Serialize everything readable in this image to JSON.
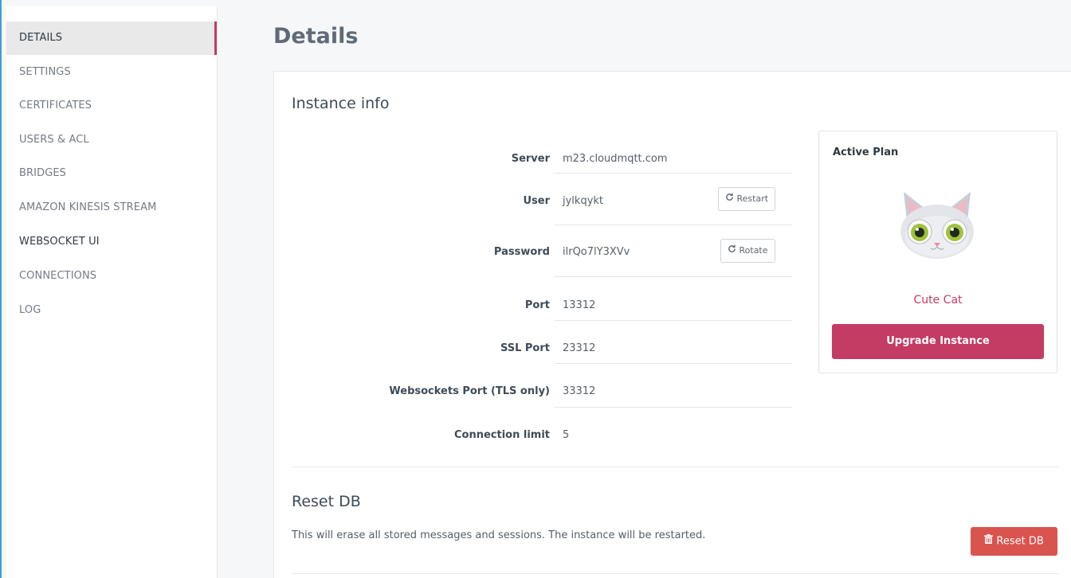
{
  "sidebar": {
    "items": [
      {
        "label": "DETAILS"
      },
      {
        "label": "SETTINGS"
      },
      {
        "label": "CERTIFICATES"
      },
      {
        "label": "USERS & ACL"
      },
      {
        "label": "BRIDGES"
      },
      {
        "label": "AMAZON KINESIS STREAM"
      },
      {
        "label": "WEBSOCKET UI"
      },
      {
        "label": "CONNECTIONS"
      },
      {
        "label": "LOG"
      }
    ],
    "active_index": 0
  },
  "page": {
    "title": "Details"
  },
  "instance_info": {
    "title": "Instance info",
    "rows": [
      {
        "label": "Server",
        "value": "m23.cloudmqtt.com"
      },
      {
        "label": "User",
        "value": "jylkqykt"
      },
      {
        "label": "Password",
        "value": "ilrQo7lY3XVv"
      },
      {
        "label": "Port",
        "value": "13312"
      },
      {
        "label": "SSL Port",
        "value": "23312"
      },
      {
        "label": "Websockets Port (TLS only)",
        "value": "33312"
      },
      {
        "label": "Connection limit",
        "value": "5"
      }
    ],
    "restart_label": "Restart",
    "rotate_label": "Rotate"
  },
  "plan": {
    "heading": "Active Plan",
    "name": "Cute Cat",
    "upgrade_label": "Upgrade Instance",
    "mascot_icon": "cat-mascot-icon"
  },
  "reset_db": {
    "title": "Reset DB",
    "description": "This will erase all stored messages and sessions. The instance will be restarted.",
    "button_label": "Reset DB"
  },
  "colors": {
    "accent": "#c43b63",
    "danger": "#d9534f",
    "left_rule": "#3b9fd0"
  }
}
